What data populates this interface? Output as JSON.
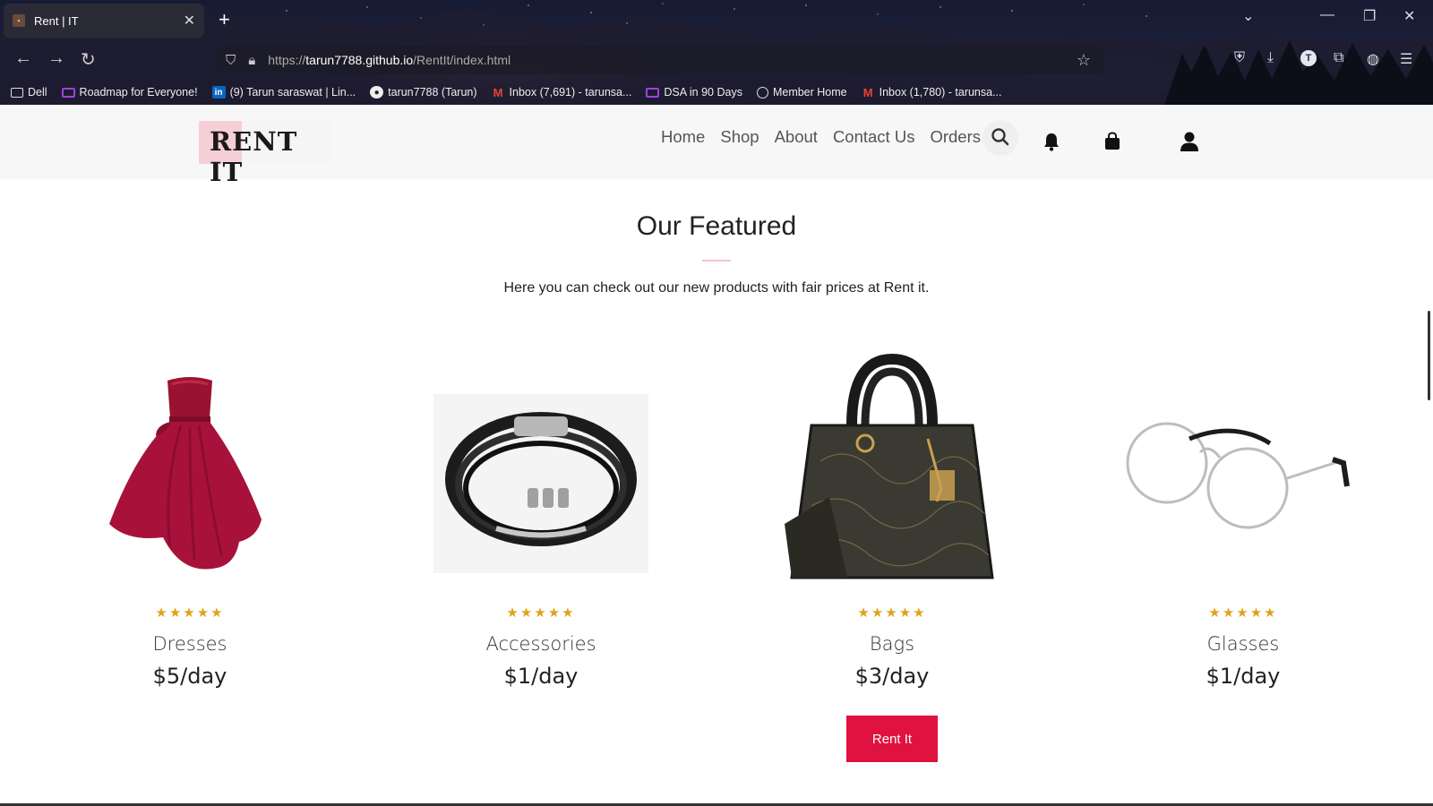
{
  "browser": {
    "tab_title": "Rent | IT",
    "url_prefix": "https://",
    "url_host": "tarun7788.github.io",
    "url_path": "/RentIt/index.html",
    "avatar_letter": "T",
    "bookmarks": [
      {
        "label": "Dell",
        "icon": "folder-icon"
      },
      {
        "label": "Roadmap for Everyone!",
        "icon": "purple-monitor-icon"
      },
      {
        "label": "(9) Tarun saraswat | Lin...",
        "icon": "linkedin-icon"
      },
      {
        "label": "tarun7788 (Tarun)",
        "icon": "github-icon"
      },
      {
        "label": "Inbox (7,691) - tarunsa...",
        "icon": "gmail-icon"
      },
      {
        "label": "DSA in 90 Days",
        "icon": "purple-monitor-icon"
      },
      {
        "label": "Member Home",
        "icon": "globe-icon"
      },
      {
        "label": "Inbox (1,780) - tarunsa...",
        "icon": "gmail-icon"
      }
    ]
  },
  "site": {
    "logo": "RENT IT",
    "menu": [
      "Home",
      "Shop",
      "About",
      "Contact Us",
      "Orders"
    ]
  },
  "featured": {
    "title": "Our Featured",
    "subtitle": "Here you can check out our new products with fair prices at Rent it.",
    "stars": "★★★★★",
    "rating": 5,
    "products": [
      {
        "name": "Dresses",
        "price": "$5/day"
      },
      {
        "name": "Accessories",
        "price": "$1/day"
      },
      {
        "name": "Bags",
        "price": "$3/day"
      },
      {
        "name": "Glasses",
        "price": "$1/day"
      }
    ],
    "button": "Rent It"
  },
  "colors": {
    "accent": "#e0123f",
    "star": "#e0a21a",
    "logo_pink": "#f6cfd6",
    "header_bg": "#f7f7f7"
  }
}
